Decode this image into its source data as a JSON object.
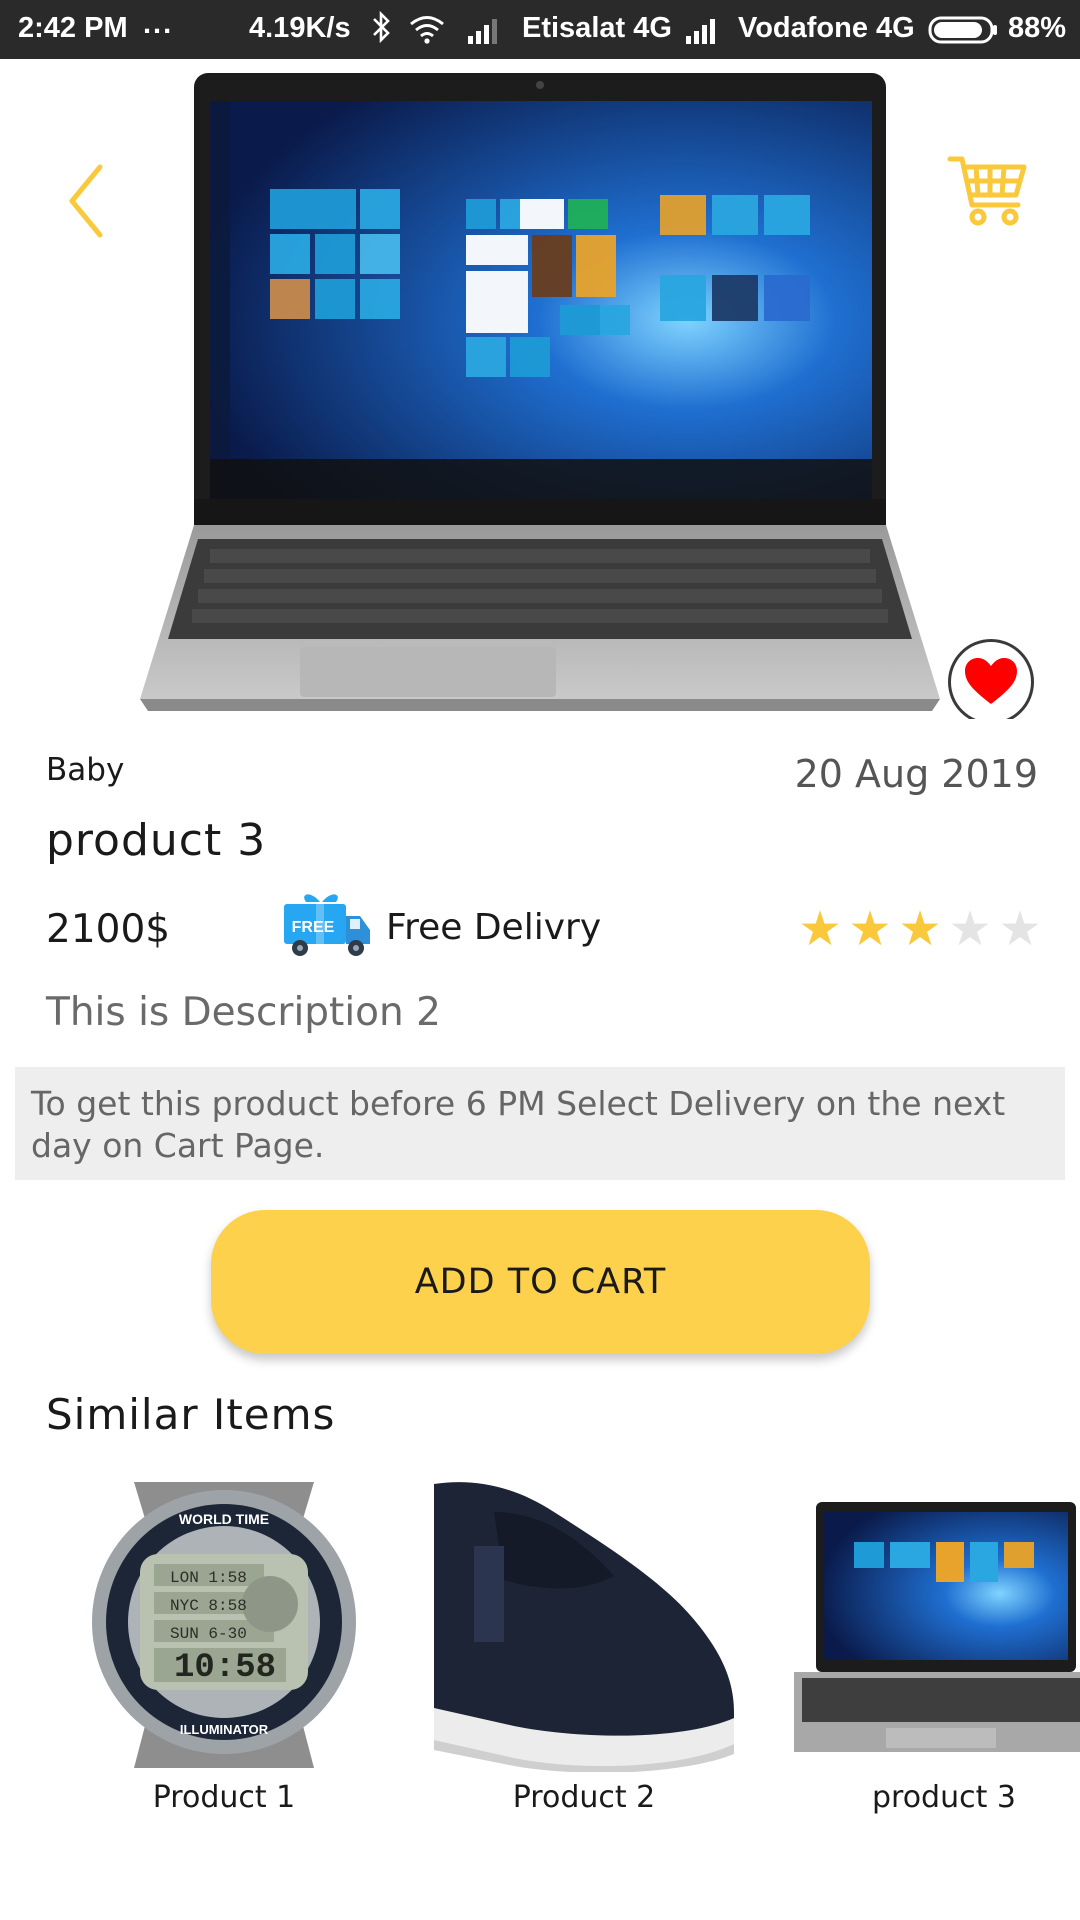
{
  "status_bar": {
    "time": "2:42 PM",
    "dots": "...",
    "speed": "4.19K/s",
    "carrier1": "Etisalat 4G",
    "carrier2": "Vodafone 4G",
    "battery": "88%",
    "battery_level": 0.88
  },
  "header": {
    "back_icon": "chevron-left-icon",
    "cart_icon": "shopping-cart-icon",
    "favorite_icon": "heart-icon",
    "accent_color": "#f9c93b",
    "favorite_color": "#ff0000"
  },
  "product": {
    "category": "Baby",
    "date": "20 Aug 2019",
    "title": "product 3",
    "price": "2100$",
    "delivery_badge": "FREE",
    "delivery_label": "Free Delivry",
    "rating": 3,
    "rating_max": 5,
    "description": "This is Description 2",
    "image": "laptop"
  },
  "notice": "To get this product before 6 PM Select Delivery on the next day on Cart Page.",
  "add_to_cart_label": "ADD TO CART",
  "button_color": "#fdd14b",
  "similar": {
    "title": "Similar Items",
    "items": [
      {
        "label": "Product 1",
        "image": "watch"
      },
      {
        "label": "Product 2",
        "image": "shoe"
      },
      {
        "label": "product 3",
        "image": "laptop"
      }
    ]
  }
}
